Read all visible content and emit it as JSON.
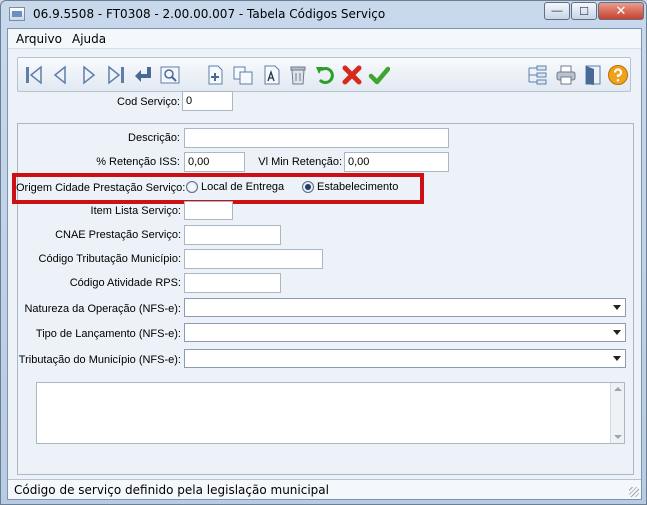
{
  "window": {
    "title": "06.9.5508 - FT0308 - 2.00.00.007 - Tabela Códigos Serviço",
    "min_glyph": "—",
    "max_glyph": "☐",
    "close_glyph": "✕"
  },
  "menu": {
    "items": [
      "Arquivo",
      "Ajuda"
    ]
  },
  "toolbar": {
    "icons": [
      "first-record-icon",
      "previous-record-icon",
      "next-record-icon",
      "last-record-icon",
      "return-icon",
      "search-icon",
      "new-record-icon",
      "copy-record-icon",
      "edit-record-icon",
      "delete-record-icon",
      "undo-icon",
      "cancel-icon",
      "confirm-icon",
      "tree-view-icon",
      "print-icon",
      "exit-icon",
      "help-icon"
    ]
  },
  "form": {
    "cod_servico": {
      "label": "Cod Serviço:",
      "value": "0"
    },
    "descricao": {
      "label": "Descrição:",
      "value": ""
    },
    "retencao_iss": {
      "label": "% Retenção ISS:",
      "value": "0,00"
    },
    "vl_min_retencao": {
      "label": "Vl Min Retenção:",
      "value": "0,00"
    },
    "origem_cidade": {
      "label": "Origem Cidade Prestação Serviço:",
      "options": [
        "Local de Entrega",
        "Estabelecimento"
      ],
      "selected": "Estabelecimento"
    },
    "item_lista_servico": {
      "label": "Item Lista Serviço:",
      "value": ""
    },
    "cnae_prestacao": {
      "label": "CNAE Prestação Serviço:",
      "value": ""
    },
    "codigo_tributacao": {
      "label": "Código Tributação Município:",
      "value": ""
    },
    "codigo_atividade_rps": {
      "label": "Código Atividade RPS:",
      "value": ""
    },
    "natureza_operacao": {
      "label": "Natureza da Operação (NFS-e):",
      "value": ""
    },
    "tipo_lancamento": {
      "label": "Tipo de Lançamento (NFS-e):",
      "value": ""
    },
    "tributacao_municipio": {
      "label": "Tributação do Município (NFS-e):",
      "value": ""
    },
    "observacao": {
      "value": ""
    }
  },
  "status": {
    "text": "Código de serviço definido pela legislação municipal"
  },
  "colors": {
    "highlight": "#cc1016",
    "undo_green": "#2e9e2a",
    "cancel_red": "#d52b1e",
    "confirm_green": "#3ea62e",
    "help_orange": "#f1a21a"
  }
}
